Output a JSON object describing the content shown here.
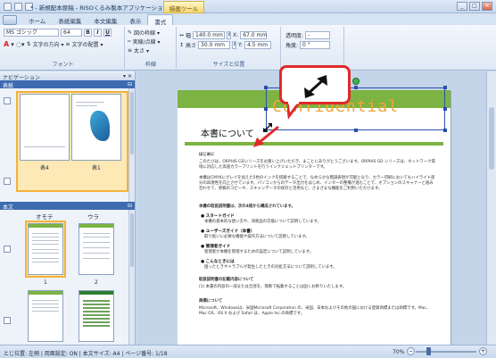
{
  "window": {
    "title": "* - 新規配本原稿 - RISOくるみ製本アプリケーション",
    "context_tab": "描画ツール"
  },
  "tabs": [
    "ホーム",
    "表紙編集",
    "本文編集",
    "表示",
    "書式"
  ],
  "active_tab": "書式",
  "ribbon": {
    "font": {
      "name": "MS ゴシック",
      "size": "64",
      "bold": "B",
      "italic": "I",
      "underline": "U",
      "text_direction": "文字の方向 ▾",
      "text_align": "文字の配置 ▾",
      "label": "フォント"
    },
    "border": {
      "fill": "図の枠線 ▾",
      "line": "実線/点線 ▾",
      "weight": "太さ ▾",
      "label": "枠線"
    },
    "size": {
      "width_label": "幅",
      "width_value": "140.0 mm",
      "height_label": "高さ",
      "height_value": "30.0 mm",
      "x_label": "X:",
      "x_value": "67.0 mm",
      "y_label": "Y:",
      "y_value": "4.5 mm",
      "label": "サイズと位置"
    },
    "transparency": {
      "label": "透明度:",
      "value": "-",
      "angle_label": "角度:",
      "angle_value": "0 °"
    }
  },
  "navigation": {
    "title": "ナビゲーション",
    "pin": "▾ ✕",
    "cover_section": "表紙",
    "cover_labels": [
      "表4",
      "表1"
    ],
    "body_section": "本文",
    "body_columns": [
      "オモテ",
      "ウラ"
    ],
    "body_page_labels": [
      "1",
      "2"
    ]
  },
  "document": {
    "stamp_text": "Confidential",
    "heading": "本書について",
    "intro_label": "はじめに",
    "para1": "このたびは、ORPHIS GDシリーズをお買い上げいただき、まことにありがとうございます。ORPHIS GD シリーズは、ネットワーク環境に対応した高速カラープリントを行うインクジェットプリンターです。",
    "para2": "本機はCMYKにグレイを加えた5色のインクを搭載することで、なめらかな階調表現が可能となり、カラー印刷においてもハイライト部分の再現性を向上させています。パソコンからのデータ出力をはじめ、インターの整備が進むことで、オプションのスキャナーと組み合わせて、原稿のコピーや、スキャンデータの保存と活用など、さまざまな機能をご利用いただけます。",
    "para3": "本機の取扱説明書は、次の4冊から構成されています。",
    "b1_title": "● スタートガイド",
    "b1_text": "本機の基本的な使い方や、消耗品の交換について説明しています。",
    "b2_title": "● ユーザーズガイド（本書）",
    "b2_text": "取り扱いに必要な機能や操作方法について説明しています。",
    "b3_title": "● 管理者ガイド",
    "b3_text": "管理者が本機を管理するための設定について説明しています。",
    "b4_title": "● こんなときには",
    "b4_text": "困ったときやトラブルが発生したときの対処方法について説明しています。",
    "sec2_title": "取扱説明書の記載内容について",
    "sec2_text": "(1) 本書の内容の一部または全部を、無断で転載することは固くお断りいたします。",
    "sec3_title": "商標について",
    "sec3_text": "Microsoft、Windowsは、米国Microsoft Corporation の、米国、日本およびその他の国における登録商標または商標です。Mac、Mac OS、OS X および Safari は、Apple Inc.の商標です。"
  },
  "status": {
    "text": "とじ位置: 左側 | 両面設定: ON | 本文サイズ: A4 | ページ番号: 1/18",
    "zoom": "70%",
    "minus": "−",
    "plus": "+"
  }
}
